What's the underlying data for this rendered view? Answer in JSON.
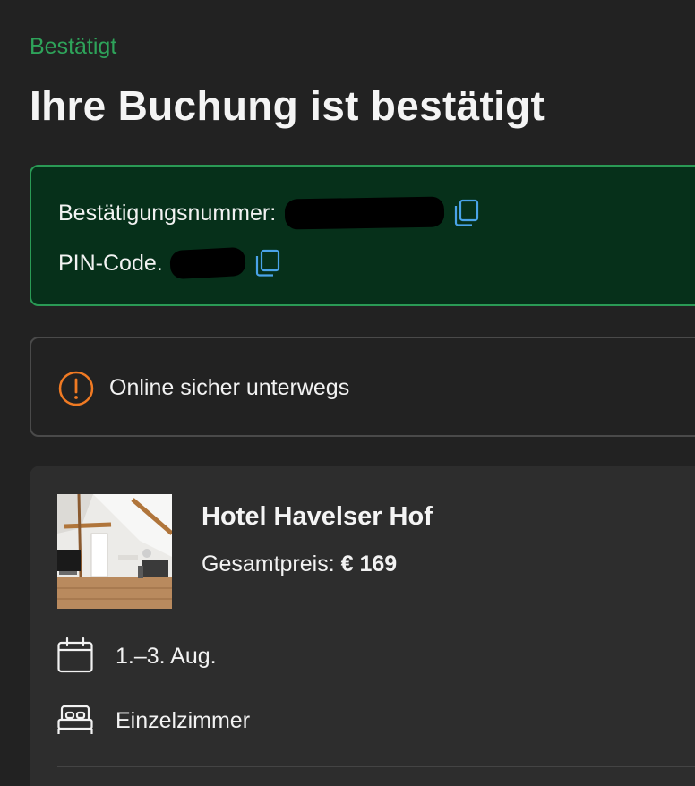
{
  "header": {
    "status": "Bestätigt",
    "title": "Ihre Buchung ist bestätigt"
  },
  "confirmation": {
    "number_label": "Bestätigungsnummer:",
    "pin_label": "PIN-Code.",
    "copy_icon": "copy-icon"
  },
  "safety_notice": {
    "icon": "warning-icon",
    "text": "Online sicher unterwegs"
  },
  "hotel": {
    "name": "Hotel Havelser Hof",
    "price_label": "Gesamtpreis:",
    "price_value": "€ 169",
    "dates": "1.–3. Aug.",
    "room": "Einzelzimmer"
  },
  "colors": {
    "background": "#222222",
    "status_green": "#2ea35a",
    "confirm_box_bg": "#06301a",
    "confirm_box_border": "#2a9a55",
    "copy_icon_blue": "#4aa3e8",
    "warning_orange": "#f07a23",
    "card_bg": "#2d2d2d"
  }
}
